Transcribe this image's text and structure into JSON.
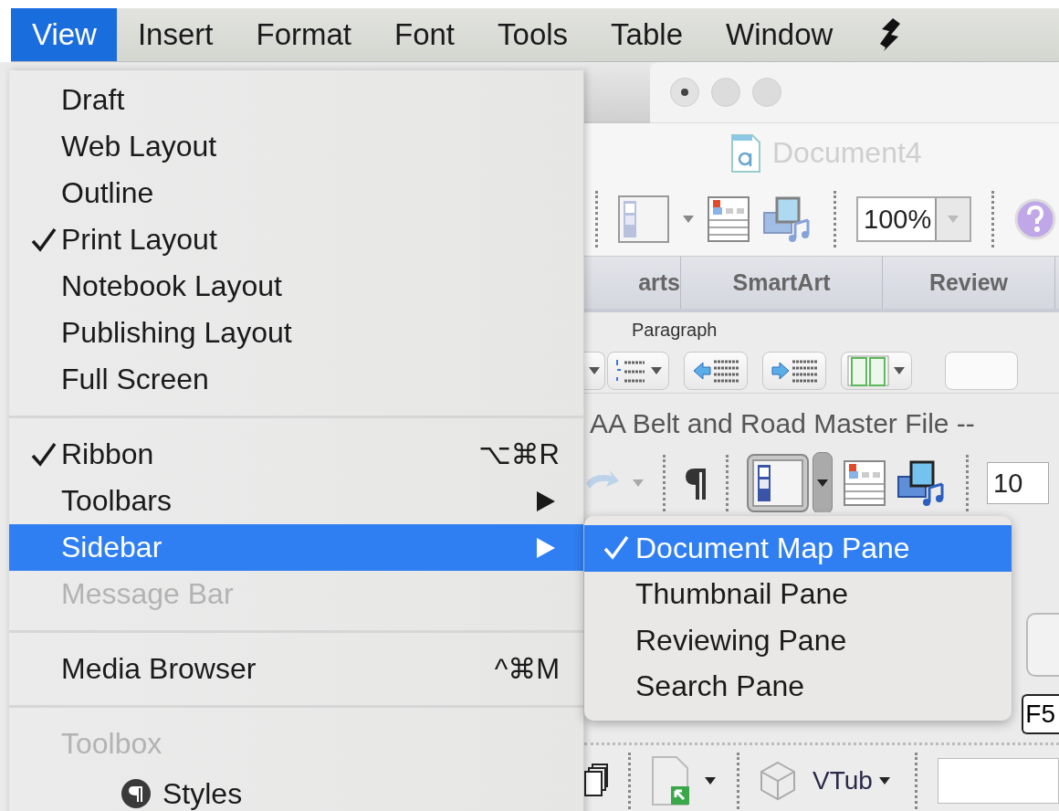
{
  "menu_bar": {
    "items": [
      {
        "label": "View",
        "selected": true
      },
      {
        "label": "Insert",
        "selected": false
      },
      {
        "label": "Format",
        "selected": false
      },
      {
        "label": "Font",
        "selected": false
      },
      {
        "label": "Tools",
        "selected": false
      },
      {
        "label": "Table",
        "selected": false
      },
      {
        "label": "Window",
        "selected": false
      }
    ]
  },
  "view_menu": {
    "items": [
      {
        "kind": "item",
        "label": "Draft",
        "checked": false,
        "disabled": false,
        "selected": false,
        "submenu": false
      },
      {
        "kind": "item",
        "label": "Web Layout",
        "checked": false,
        "disabled": false,
        "selected": false,
        "submenu": false
      },
      {
        "kind": "item",
        "label": "Outline",
        "checked": false,
        "disabled": false,
        "selected": false,
        "submenu": false
      },
      {
        "kind": "item",
        "label": "Print Layout",
        "checked": true,
        "disabled": false,
        "selected": false,
        "submenu": false
      },
      {
        "kind": "item",
        "label": "Notebook Layout",
        "checked": false,
        "disabled": false,
        "selected": false,
        "submenu": false
      },
      {
        "kind": "item",
        "label": "Publishing Layout",
        "checked": false,
        "disabled": false,
        "selected": false,
        "submenu": false
      },
      {
        "kind": "item",
        "label": "Full Screen",
        "checked": false,
        "disabled": false,
        "selected": false,
        "submenu": false
      },
      {
        "kind": "separator"
      },
      {
        "kind": "item",
        "label": "Ribbon",
        "checked": true,
        "disabled": false,
        "selected": false,
        "submenu": false,
        "shortcut": "⌥⌘R"
      },
      {
        "kind": "item",
        "label": "Toolbars",
        "checked": false,
        "disabled": false,
        "selected": false,
        "submenu": true
      },
      {
        "kind": "item",
        "label": "Sidebar",
        "checked": false,
        "disabled": false,
        "selected": true,
        "submenu": true
      },
      {
        "kind": "item",
        "label": "Message Bar",
        "checked": false,
        "disabled": true,
        "selected": false,
        "submenu": false
      },
      {
        "kind": "separator"
      },
      {
        "kind": "item",
        "label": "Media Browser",
        "checked": false,
        "disabled": false,
        "selected": false,
        "submenu": false,
        "shortcut": "^⌘M"
      },
      {
        "kind": "separator"
      },
      {
        "kind": "item",
        "label": "Toolbox",
        "checked": false,
        "disabled": true,
        "selected": false,
        "submenu": false
      },
      {
        "kind": "tool",
        "label": "Styles"
      }
    ]
  },
  "sidebar_submenu": {
    "items": [
      {
        "label": "Document Map Pane",
        "checked": true,
        "selected": true
      },
      {
        "label": "Thumbnail Pane",
        "checked": false,
        "selected": false
      },
      {
        "label": "Reviewing Pane",
        "checked": false,
        "selected": false
      },
      {
        "label": "Search Pane",
        "checked": false,
        "selected": false
      }
    ]
  },
  "document_window": {
    "title": "Document4",
    "zoom": "100%",
    "tabs": [
      {
        "label": "arts"
      },
      {
        "label": "SmartArt"
      },
      {
        "label": "Review"
      }
    ],
    "group_label": "Paragraph"
  },
  "master_window": {
    "title": "AA Belt and Road Master File --",
    "zoom": "10",
    "key_label": "F5",
    "style_menu": "VTub"
  }
}
